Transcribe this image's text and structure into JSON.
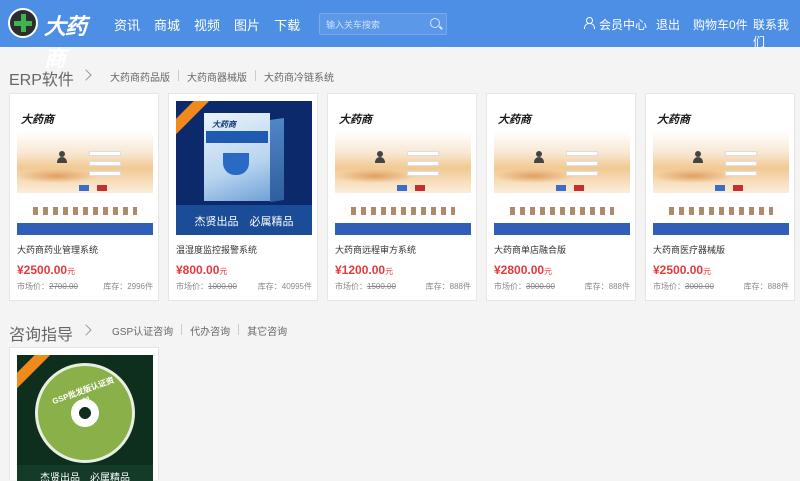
{
  "header": {
    "logo_text": "大药商",
    "nav": [
      "资讯",
      "商城",
      "视频",
      "图片",
      "下载"
    ],
    "search_placeholder": "输入关车搜索",
    "member_center": "会员中心",
    "logout": "退出",
    "cart": "购物车0件",
    "contact": "联系我们"
  },
  "sections": [
    {
      "title": "ERP软件",
      "sub_links": [
        "大药商药品版",
        "大药商器械版",
        "大药商冷链系统"
      ]
    },
    {
      "title": "咨询指导",
      "sub_links": [
        "GSP认证咨询",
        "代办咨询",
        "其它咨询"
      ]
    }
  ],
  "products": [
    {
      "name": "大药商药业管理系统",
      "price": "¥2500.00",
      "unit": "元",
      "market_label": "市场价：",
      "market_price": "2700.00",
      "stock": "库存：2996件",
      "thumb": "login"
    },
    {
      "name": "温湿度监控报警系统",
      "price": "¥800.00",
      "unit": "元",
      "market_label": "市场价：",
      "market_price": "1000.00",
      "stock": "库存：40995件",
      "thumb": "box"
    },
    {
      "name": "大药商远程审方系统",
      "price": "¥1200.00",
      "unit": "元",
      "market_label": "市场价：",
      "market_price": "1500.00",
      "stock": "库存：888件",
      "thumb": "login"
    },
    {
      "name": "大药商单店融合版",
      "price": "¥2800.00",
      "unit": "元",
      "market_label": "市场价：",
      "market_price": "3000.00",
      "stock": "库存：888件",
      "thumb": "login"
    },
    {
      "name": "大药商医疗器械版",
      "price": "¥2500.00",
      "unit": "元",
      "market_label": "市场价：",
      "market_price": "3000.00",
      "stock": "库存：888件",
      "thumb": "login"
    }
  ],
  "thumb_text": {
    "box_footer": "杰贤出品　必属精品",
    "cd_footer": "杰贤出品　必属精品",
    "cd_title": "GSP批发版认证资料"
  }
}
